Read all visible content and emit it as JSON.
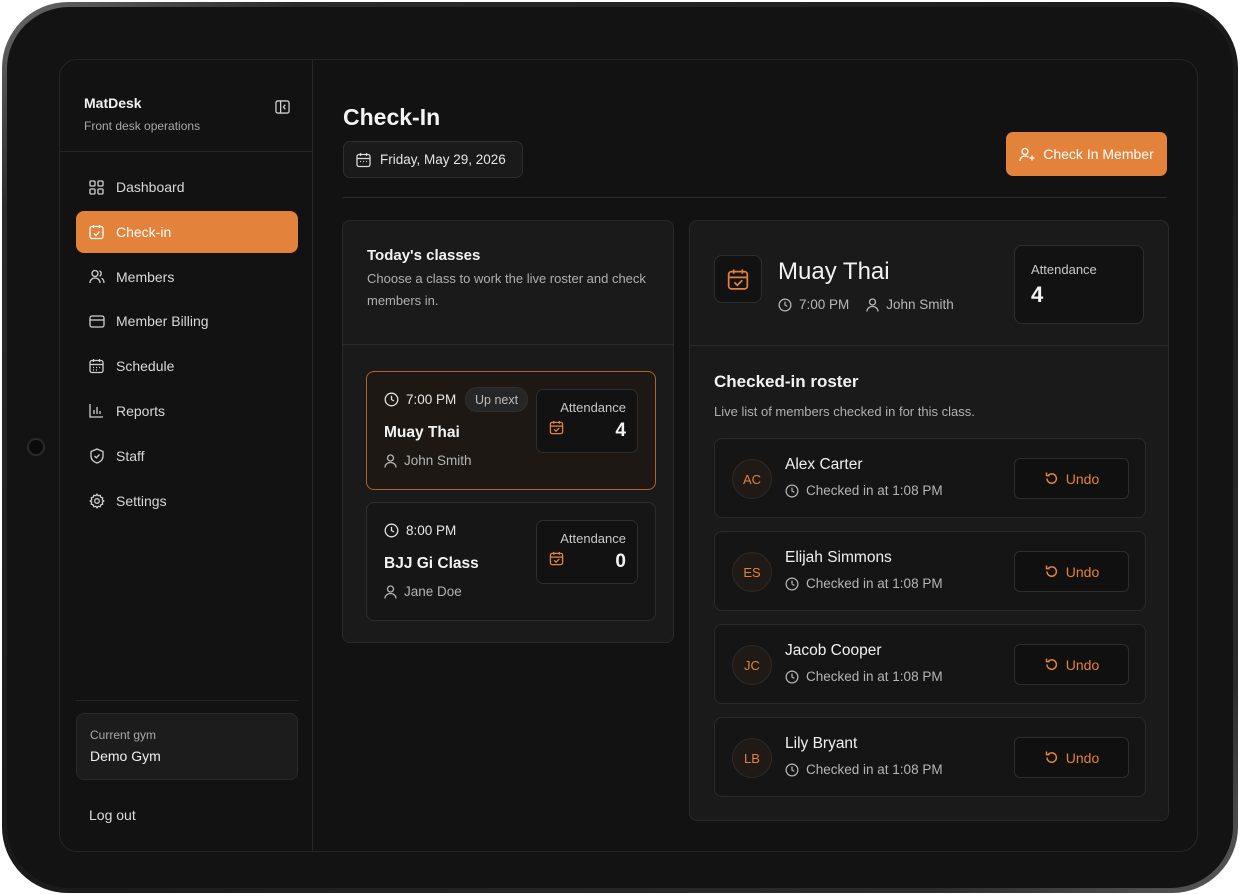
{
  "theme": {
    "accent": "#e3823a",
    "background": "#121212",
    "panel": "#1a1a1a"
  },
  "sidebar": {
    "brand_name": "MatDesk",
    "brand_subtitle": "Front desk operations",
    "items": [
      {
        "label": "Dashboard",
        "icon": "grid-icon",
        "active": false
      },
      {
        "label": "Check-in",
        "icon": "calendar-check-icon",
        "active": true
      },
      {
        "label": "Members",
        "icon": "users-icon",
        "active": false
      },
      {
        "label": "Member Billing",
        "icon": "credit-card-icon",
        "active": false
      },
      {
        "label": "Schedule",
        "icon": "calendar-icon",
        "active": false
      },
      {
        "label": "Reports",
        "icon": "bar-chart-icon",
        "active": false
      },
      {
        "label": "Staff",
        "icon": "shield-icon",
        "active": false
      },
      {
        "label": "Settings",
        "icon": "gear-icon",
        "active": false
      }
    ],
    "gym_label": "Current gym",
    "gym_name": "Demo Gym",
    "logout_label": "Log out"
  },
  "header": {
    "title": "Check-In",
    "date": "Friday, May 29, 2026",
    "primary_action": "Check In Member"
  },
  "classes": {
    "title": "Today's classes",
    "description": "Choose a class to work the live roster and check members in.",
    "attendance_label": "Attendance",
    "items": [
      {
        "time": "7:00 PM",
        "badge": "Up next",
        "name": "Muay Thai",
        "instructor": "John Smith",
        "attendance": "4",
        "selected": true
      },
      {
        "time": "8:00 PM",
        "badge": "",
        "name": "BJJ Gi Class",
        "instructor": "Jane Doe",
        "attendance": "0",
        "selected": false
      }
    ]
  },
  "selected_class": {
    "name": "Muay Thai",
    "time": "7:00 PM",
    "instructor": "John Smith",
    "attendance_label": "Attendance",
    "attendance": "4"
  },
  "roster": {
    "title": "Checked-in roster",
    "subtitle": "Live list of members checked in for this class.",
    "undo_label": "Undo",
    "members": [
      {
        "initials": "AC",
        "name": "Alex Carter",
        "checked_in": "Checked in at 1:08 PM"
      },
      {
        "initials": "ES",
        "name": "Elijah Simmons",
        "checked_in": "Checked in at 1:08 PM"
      },
      {
        "initials": "JC",
        "name": "Jacob Cooper",
        "checked_in": "Checked in at 1:08 PM"
      },
      {
        "initials": "LB",
        "name": "Lily Bryant",
        "checked_in": "Checked in at 1:08 PM"
      }
    ]
  }
}
